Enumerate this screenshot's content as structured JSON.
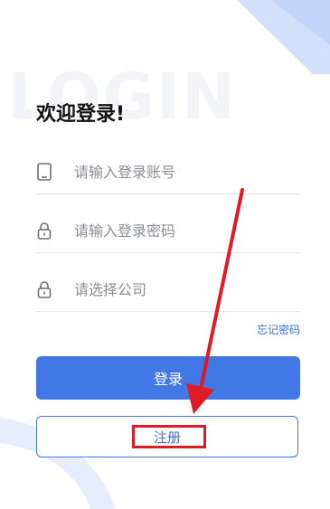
{
  "background_word": "LOGIN",
  "welcome_title": "欢迎登录!",
  "fields": {
    "account": {
      "placeholder": "请输入登录账号",
      "value": "",
      "icon": "phone-icon"
    },
    "password": {
      "placeholder": "请输入登录密码",
      "value": "",
      "icon": "lock-icon"
    },
    "company": {
      "placeholder": "请选择公司",
      "value": "",
      "icon": "lock-icon"
    }
  },
  "forgot_password": "忘记密码",
  "login_button": "登录",
  "register_button": "注册",
  "annotation": {
    "arrow_color": "#e01b24",
    "box_color": "#e01b24"
  },
  "colors": {
    "accent": "#4277e6",
    "link": "#3f6fd6",
    "deco": "#d6e3fb"
  }
}
